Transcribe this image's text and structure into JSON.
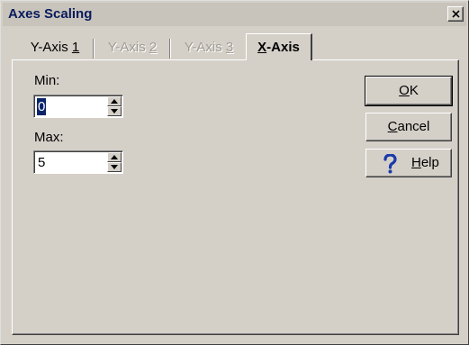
{
  "window": {
    "title": "Axes Scaling",
    "close_symbol": "×"
  },
  "tabs": [
    {
      "label_pre": "Y-Axis ",
      "mnemonic": "1",
      "label_post": "",
      "state": "enabled"
    },
    {
      "label_pre": "Y-Axis ",
      "mnemonic": "2",
      "label_post": "",
      "state": "disabled"
    },
    {
      "label_pre": "Y-Axis ",
      "mnemonic": "3",
      "label_post": "",
      "state": "disabled"
    },
    {
      "label_pre": "",
      "mnemonic": "X",
      "label_post": "-Axis",
      "state": "active"
    }
  ],
  "fields": {
    "min": {
      "label": "Min:",
      "value": "0",
      "selected": true
    },
    "max": {
      "label": "Max:",
      "value": "5",
      "selected": false
    }
  },
  "buttons": {
    "ok": {
      "mnemonic": "O",
      "rest": "K"
    },
    "cancel": {
      "mnemonic": "C",
      "rest": "ancel"
    },
    "help": {
      "mnemonic": "H",
      "rest": "elp",
      "icon": "question-mark-icon",
      "icon_color": "#1a3aa8"
    }
  },
  "colors": {
    "face": "#d4d0c8",
    "selection": "#0a246a",
    "title_text": "#0a1a5c"
  }
}
